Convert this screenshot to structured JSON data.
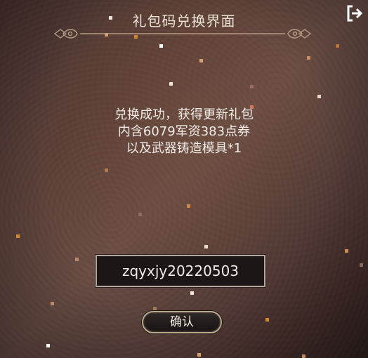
{
  "header": {
    "title": "礼包码兑换界面"
  },
  "message": {
    "lines": [
      "兑换成功，获得更新礼包",
      "内含6079军资383点券",
      "以及武器铸造模具*1"
    ]
  },
  "code_input": {
    "value": "zqyxjy20220503"
  },
  "confirm_button": {
    "label": "确认"
  },
  "icons": {
    "logout": "exit-icon",
    "ornament": "divider-ornament"
  },
  "colors": {
    "background": "#5b3f38",
    "text": "#ece4da",
    "ornament": "#b49a86",
    "button_border": "#b9aa8f",
    "input_bg": "#1c1616"
  }
}
